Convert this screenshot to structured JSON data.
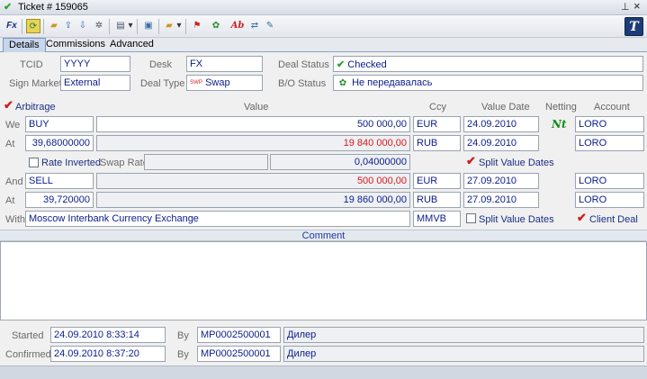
{
  "window": {
    "title": "Ticket # 159065",
    "pin_glyph": "⊥",
    "close_glyph": "×"
  },
  "toolbar": {
    "buttons": [
      "Fx",
      "refresh",
      "open",
      "upload",
      "download",
      "settings",
      "print",
      "preview",
      "folder",
      "flag",
      "bug",
      "Ab",
      "route",
      "edit"
    ],
    "ab_label": "Ab",
    "fx_label": "Fx",
    "logo": "T"
  },
  "tabs": [
    {
      "label": "Details",
      "active": true
    },
    {
      "label": "Commissions",
      "active": false
    },
    {
      "label": "Advanced",
      "active": false
    }
  ],
  "header": {
    "tcid_label": "TCID",
    "tcid_value": "YYYY",
    "desk_label": "Desk",
    "desk_value": "FX",
    "deal_status_label": "Deal Status",
    "deal_status_value": "Checked",
    "sign_market_label": "Sign Market",
    "sign_market_value": "External",
    "deal_type_label": "Deal Type",
    "deal_type_value": "Swap",
    "deal_type_icon": "SWP",
    "bo_status_label": "B/O Status",
    "bo_status_value": "Не передавалась"
  },
  "columns": {
    "arbitrage": "Arbitrage",
    "value": "Value",
    "ccy": "Ccy",
    "value_date": "Value Date",
    "netting": "Netting",
    "account": "Account"
  },
  "rows": {
    "we": {
      "label": "We",
      "side": "BUY",
      "value": "500 000,00",
      "ccy": "EUR",
      "date": "24.09.2010",
      "account": "LORO"
    },
    "at1": {
      "label": "At",
      "rate": "39,68000000",
      "value": "19 840 000,00",
      "ccy": "RUB",
      "date": "24.09.2010",
      "account": "LORO"
    },
    "swap": {
      "rate_inverted": "Rate Inverted",
      "swap_rate_label": "Swap Rate",
      "swap_rate": "0,04000000",
      "split": "Split Value Dates"
    },
    "and": {
      "label": "And",
      "side": "SELL",
      "value": "500 000,00",
      "ccy": "EUR",
      "date": "27.09.2010",
      "account": "LORO"
    },
    "at2": {
      "label": "At",
      "rate": "39,720000",
      "value": "19 860 000,00",
      "ccy": "RUB",
      "date": "27.09.2010",
      "account": "LORO"
    },
    "with": {
      "label": "With",
      "counterparty": "Moscow Interbank Currency Exchange",
      "venue": "MMVB",
      "split": "Split Value Dates",
      "client_deal": "Client Deal"
    }
  },
  "netting_glyph": "Nt",
  "comment": {
    "label": "Comment",
    "text": ""
  },
  "footer": {
    "started_label": "Started",
    "started_value": "24.09.2010 8:33:14",
    "started_by_label": "By",
    "started_by_value": "MP0002500001",
    "started_role": "Дилер",
    "confirmed_label": "Confirmed",
    "confirmed_value": "24.09.2010 8:37:20",
    "confirmed_by_label": "By",
    "confirmed_by_value": "MP0002500001",
    "confirmed_role": "Дилер"
  },
  "colors": {
    "accent": "#0a1d8a",
    "negative": "#d81a1a",
    "check_red": "#cc1f1f",
    "check_green": "#2aa52a"
  }
}
